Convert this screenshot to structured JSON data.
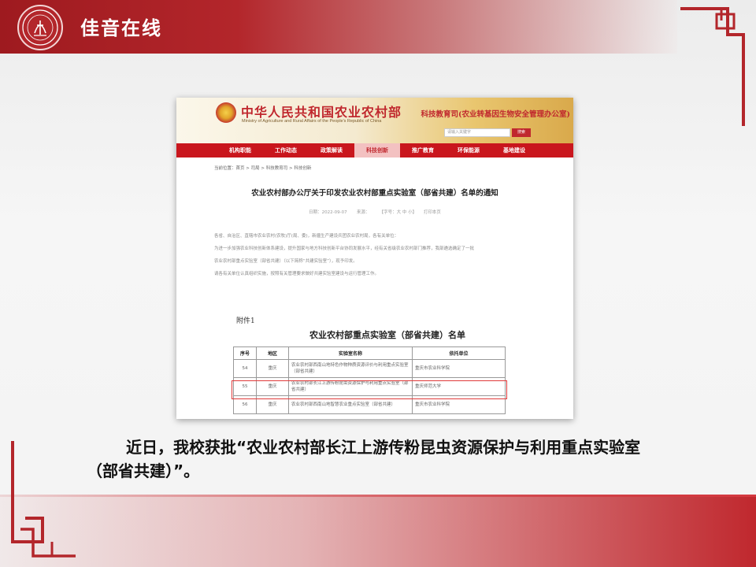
{
  "header": {
    "title": "佳音在线",
    "brand_color": "#b3262b"
  },
  "screenshot": {
    "ministry_name": "中华人民共和国农业农村部",
    "ministry_en": "Ministry of Agriculture and Rural Affairs of the People's Republic of China",
    "dept_name": "科技教育司(农业转基因生物安全管理办公室)",
    "search_placeholder": "请输入关键字",
    "search_button": "搜索",
    "nav": [
      {
        "label": "机构职能"
      },
      {
        "label": "工作动态"
      },
      {
        "label": "政策解读"
      },
      {
        "label": "科技创新",
        "active": true
      },
      {
        "label": "推广教育"
      },
      {
        "label": "环保能源"
      },
      {
        "label": "基地建设"
      }
    ],
    "breadcrumb": "当前位置：首页 > 司局 > 科技教育司 > 科技创新",
    "notice_title": "农业农村部办公厅关于印发农业农村部重点实验室（部省共建）名单的通知",
    "meta_date": "日期：2022-09-07",
    "meta_source": "来源：",
    "meta_font": "【字号：大 中 小】",
    "meta_print": "打印本页",
    "body_lines": [
      "各省、自治区、直辖市农业农村(农牧)厅(局、委)，新疆生产建设兵团农业农村局，各有关单位：",
      "为进一步加强农业科技创新体系建设，提升国家与地方科技创新平台协同发展水平，经有关省级农业农村部门推荐，我部遴选确定了一批",
      "农业农村部重点实验室（部省共建）（以下简称“共建实验室”），现予印发。",
      "请各有关单位认真组织实施，按照有关管理要求做好共建实验室建设与运行管理工作。"
    ],
    "attachment_label": "附件1",
    "list_title": "农业农村部重点实验室（部省共建）名单",
    "table": {
      "headers": [
        "序号",
        "地区",
        "实验室名称",
        "依托单位"
      ],
      "rows": [
        [
          "54",
          "重庆",
          "农业农村部西南山地特色作物种质资源评价与利用重点实验室（部省共建）",
          "重庆市农业科学院"
        ],
        [
          "55",
          "重庆",
          "农业农村部长江上游传粉昆虫资源保护与利用重点实验室（部省共建）",
          "重庆师范大学"
        ],
        [
          "56",
          "重庆",
          "农业农村部西南山地智慧农业重点实验室（部省共建）",
          "重庆市农业科学院"
        ]
      ],
      "highlighted_row": 2
    }
  },
  "caption": {
    "text": "近日，我校获批“农业农村部长江上游传粉昆虫资源保护与利用重点实验室（部省共建）”。"
  }
}
